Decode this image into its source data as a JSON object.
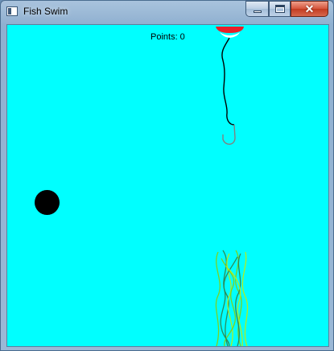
{
  "window": {
    "title": "Fish Swim",
    "app_icon": "window-app-icon",
    "controls": {
      "minimize_icon": "minimize-icon",
      "maximize_icon": "maximize-icon",
      "close_glyph": "✕"
    }
  },
  "hud": {
    "points_label": "Points:",
    "points_value": 0,
    "points_text": "Points: 0"
  },
  "scene": {
    "background_color": "#00ffff",
    "bobber_colors": {
      "top": "#e8202a",
      "bottom": "#ffffff"
    },
    "line_color": "#000000",
    "hook_color": "#808080",
    "ball_color": "#000000",
    "seaweed_colors": [
      "#7cd321",
      "#2e8b57",
      "#b0ee20"
    ]
  }
}
